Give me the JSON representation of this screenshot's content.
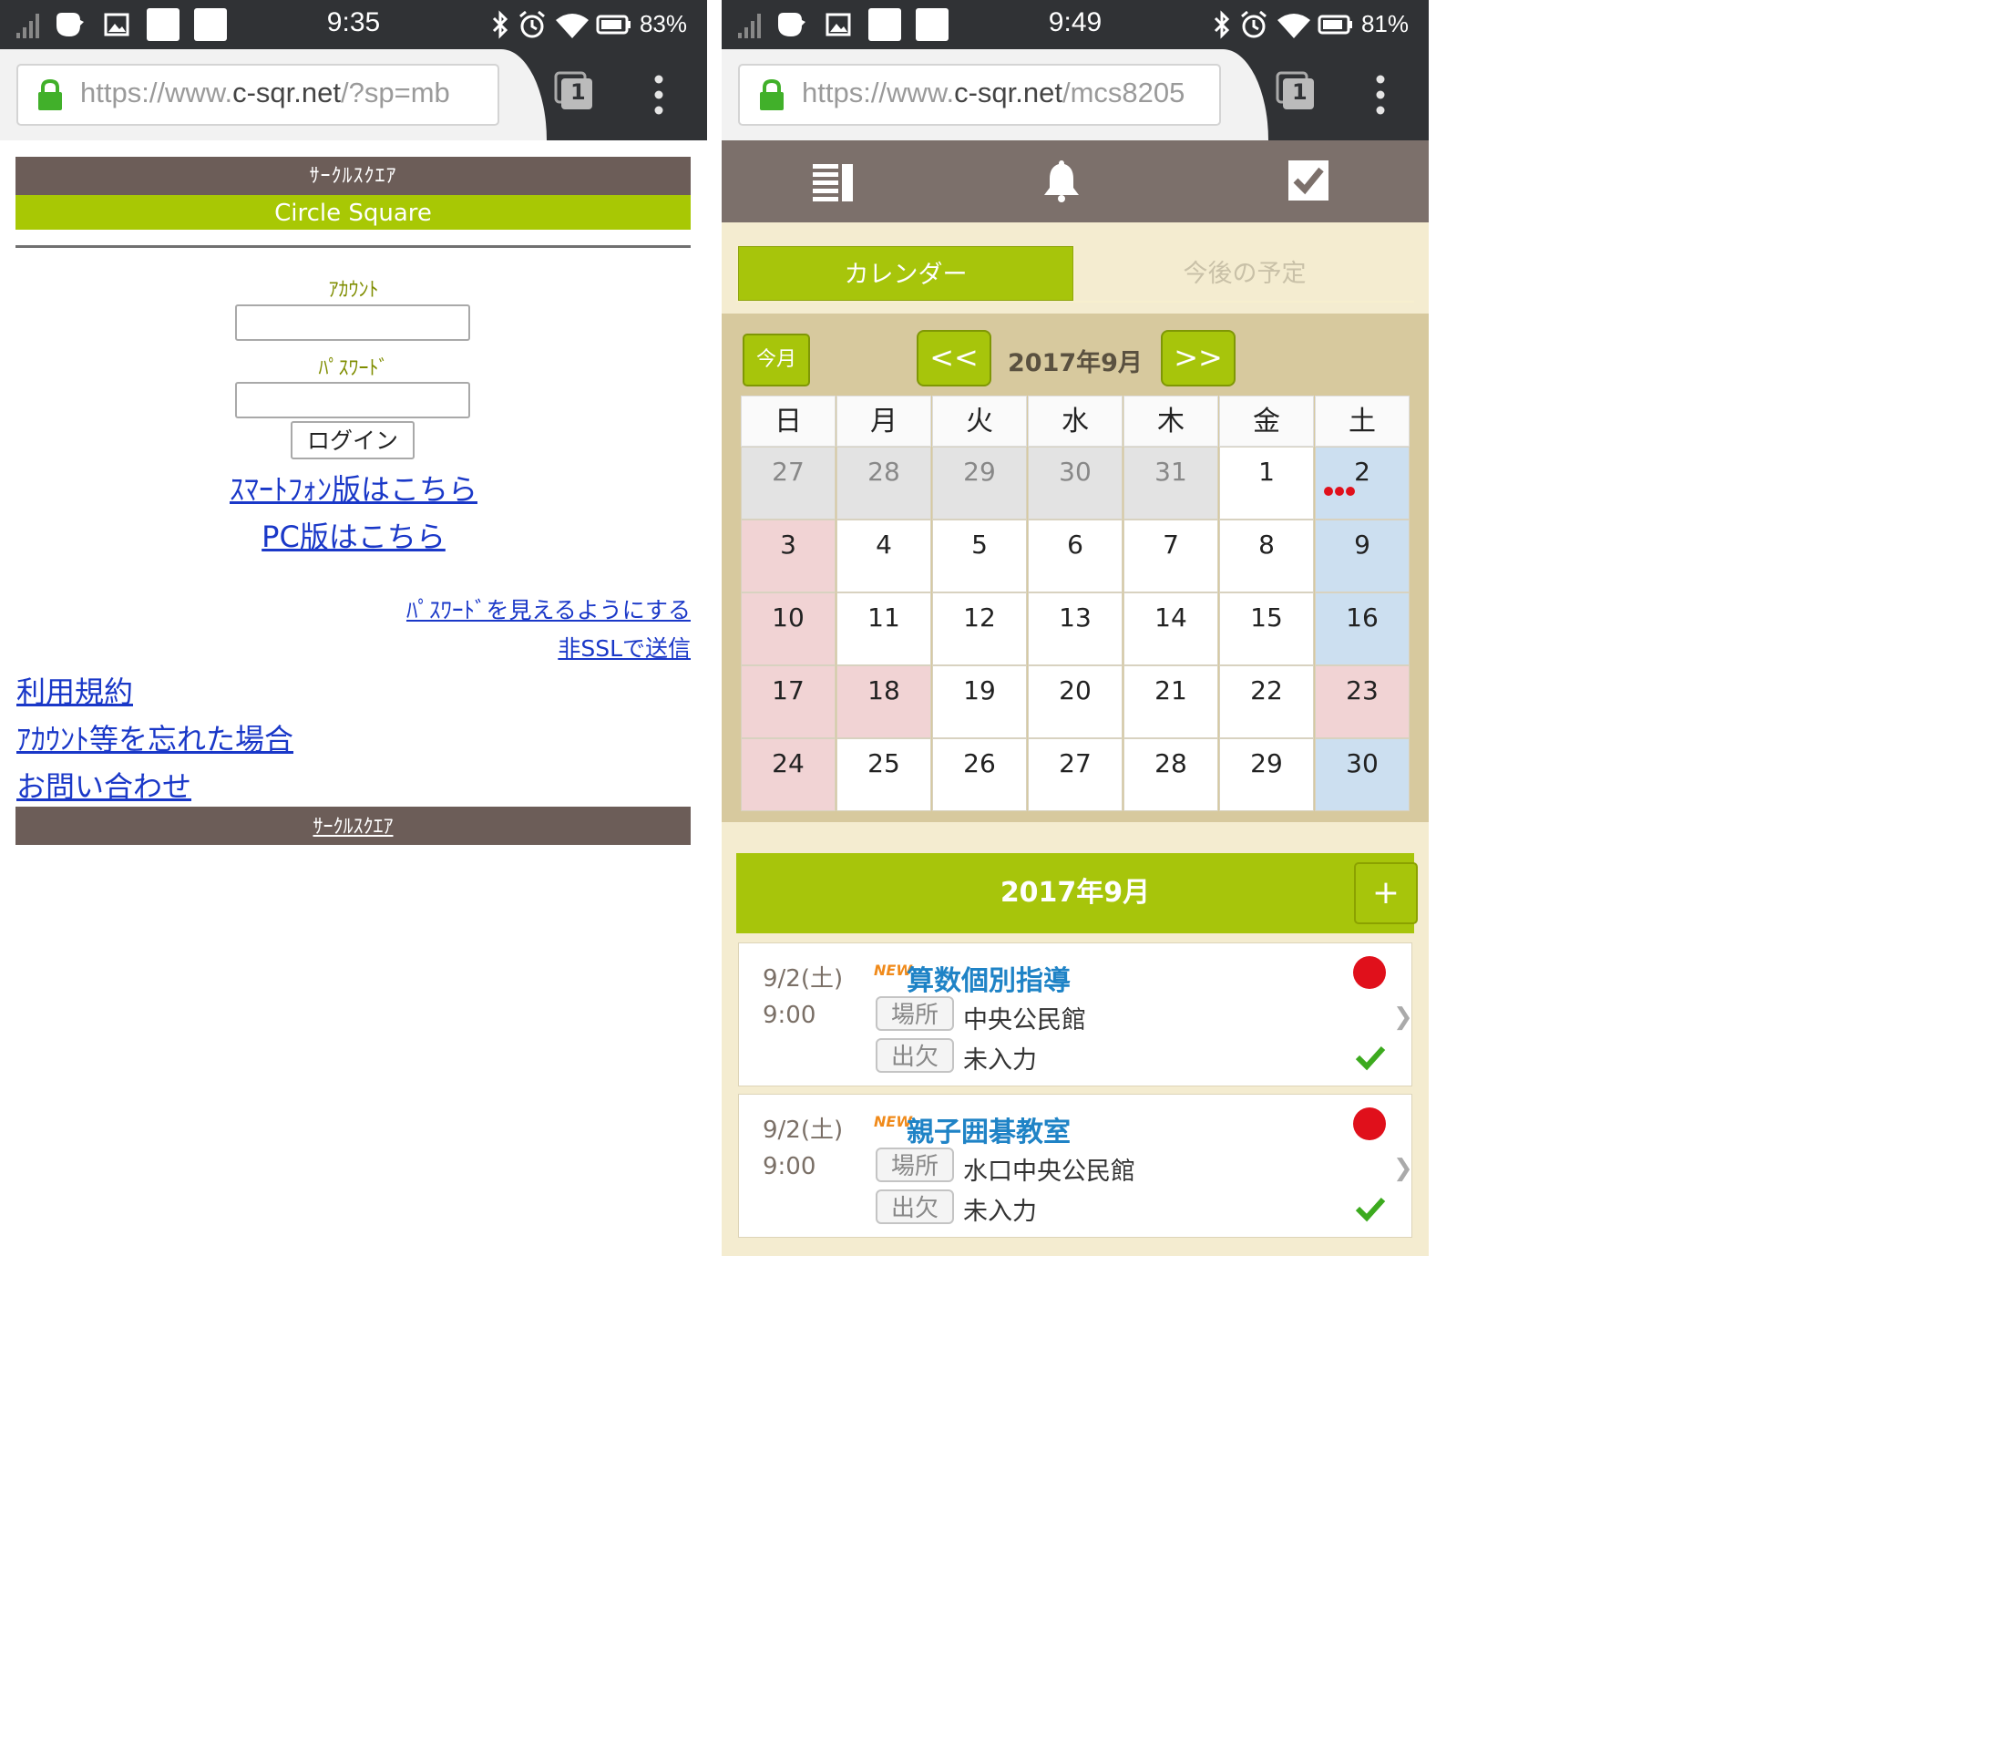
{
  "left": {
    "status": {
      "time": "9:35",
      "battery": "83%"
    },
    "browser": {
      "url_scheme": "https://www.",
      "url_host": "c-sqr.net",
      "url_path": "/?sp=mb",
      "tab_count": "1"
    },
    "header": {
      "title": "ｻｰｸﾙｽｸｴｱ",
      "subtitle": "Circle Square"
    },
    "form": {
      "account_label": "ｱｶｳﾝﾄ",
      "password_label": "ﾊﾟｽﾜｰﾄﾞ",
      "login_button": "ログイン"
    },
    "links": {
      "smartphone": "ｽﾏｰﾄﾌｫﾝ版はこちら",
      "pc": "PC版はこちら",
      "show_password": "ﾊﾟｽﾜｰﾄﾞを見えるようにする",
      "non_ssl": "非SSLで送信",
      "terms": "利用規約",
      "forgot": "ｱｶｳﾝﾄ等を忘れた場合",
      "contact": "お問い合わせ"
    },
    "footer": "ｻｰｸﾙｽｸｴｱ"
  },
  "right": {
    "status": {
      "time": "9:49",
      "battery": "81%"
    },
    "browser": {
      "url_scheme": "https://www.",
      "url_host": "c-sqr.net",
      "url_path": "/mcs8205",
      "tab_count": "1"
    },
    "tabs": {
      "calendar": "カレンダー",
      "upcoming": "今後の予定"
    },
    "calendar": {
      "today_button": "今月",
      "prev_button": "<<",
      "next_button": ">>",
      "month_label": "2017年9月",
      "weekdays": [
        "日",
        "月",
        "火",
        "水",
        "木",
        "金",
        "土"
      ],
      "weeks": [
        [
          {
            "d": "27",
            "t": "gray"
          },
          {
            "d": "28",
            "t": "gray"
          },
          {
            "d": "29",
            "t": "gray"
          },
          {
            "d": "30",
            "t": "gray"
          },
          {
            "d": "31",
            "t": "gray"
          },
          {
            "d": "1",
            "t": "white"
          },
          {
            "d": "2",
            "t": "blue",
            "dots": 3
          }
        ],
        [
          {
            "d": "3",
            "t": "pink"
          },
          {
            "d": "4",
            "t": "white"
          },
          {
            "d": "5",
            "t": "white"
          },
          {
            "d": "6",
            "t": "white"
          },
          {
            "d": "7",
            "t": "white"
          },
          {
            "d": "8",
            "t": "white"
          },
          {
            "d": "9",
            "t": "blue"
          }
        ],
        [
          {
            "d": "10",
            "t": "pink"
          },
          {
            "d": "11",
            "t": "white"
          },
          {
            "d": "12",
            "t": "white"
          },
          {
            "d": "13",
            "t": "white"
          },
          {
            "d": "14",
            "t": "white"
          },
          {
            "d": "15",
            "t": "white"
          },
          {
            "d": "16",
            "t": "blue"
          }
        ],
        [
          {
            "d": "17",
            "t": "pink"
          },
          {
            "d": "18",
            "t": "pink"
          },
          {
            "d": "19",
            "t": "white"
          },
          {
            "d": "20",
            "t": "white"
          },
          {
            "d": "21",
            "t": "white"
          },
          {
            "d": "22",
            "t": "white"
          },
          {
            "d": "23",
            "t": "pink"
          }
        ],
        [
          {
            "d": "24",
            "t": "pink"
          },
          {
            "d": "25",
            "t": "white"
          },
          {
            "d": "26",
            "t": "white"
          },
          {
            "d": "27",
            "t": "white"
          },
          {
            "d": "28",
            "t": "white"
          },
          {
            "d": "29",
            "t": "white"
          },
          {
            "d": "30",
            "t": "blue"
          }
        ]
      ]
    },
    "list": {
      "header": "2017年9月",
      "add_button": "+",
      "events": [
        {
          "date": "9/2(土)",
          "time": "9:00",
          "badge": "NEW",
          "title": "算数個別指導",
          "place_tag": "場所",
          "place": "中央公民館",
          "attend_tag": "出欠",
          "attend": "未入力"
        },
        {
          "date": "9/2(土)",
          "time": "9:00",
          "badge": "NEW",
          "title": "親子囲碁教室",
          "place_tag": "場所",
          "place": "水口中央公民館",
          "attend_tag": "出欠",
          "attend": "未入力"
        }
      ]
    }
  },
  "colors": {
    "brand_brown": "#6c5d58",
    "brand_green": "#a8c804",
    "link_blue": "#1a38c8",
    "status_bar": "#303235"
  }
}
